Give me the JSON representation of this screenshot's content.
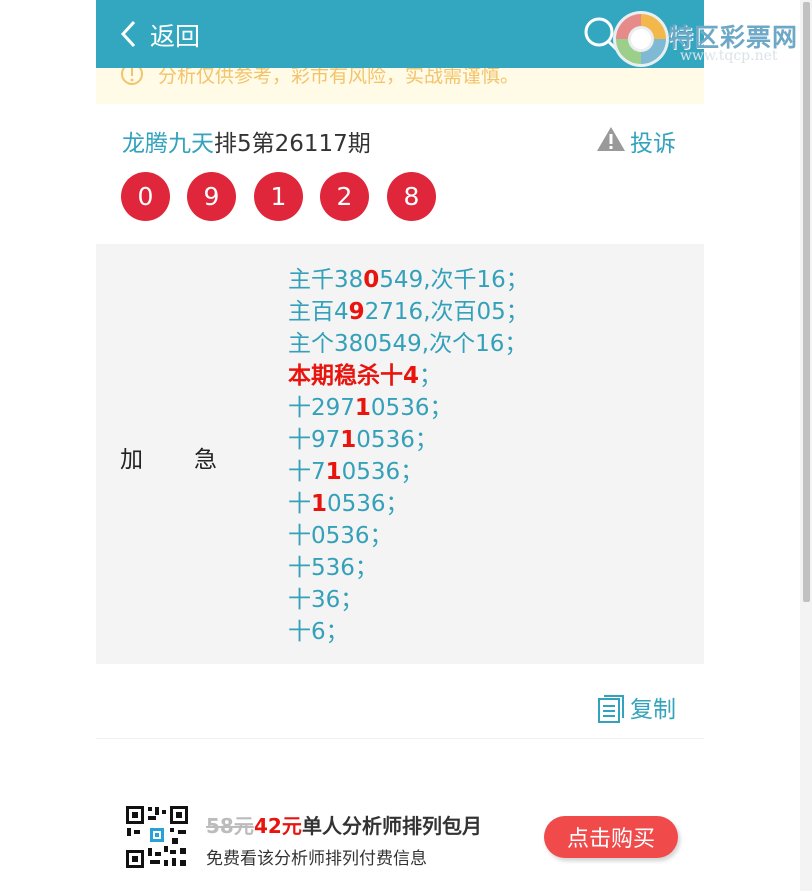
{
  "header": {
    "back_label": "返回"
  },
  "watermark": {
    "title": "特区彩票网",
    "url": "www.tqcp.net"
  },
  "notice": {
    "text": "分析仅供参考，彩市有风险，实战需谨慎。"
  },
  "post": {
    "author": "龙腾九天",
    "issue": "排5第26117期",
    "complain_label": "投诉",
    "balls": [
      "0",
      "9",
      "1",
      "2",
      "8"
    ]
  },
  "analysis": {
    "tag_part1": "加",
    "tag_part2": "急",
    "lines": [
      {
        "a": "主千38",
        "b": "0",
        "c": "549,次千16；"
      },
      {
        "a": "主百4",
        "b": "9",
        "c": "2716,次百05；"
      },
      {
        "a": "主个380549,次个16；",
        "b": "",
        "c": ""
      },
      {
        "a": "",
        "b": "本期稳杀十4",
        "c": "；"
      },
      {
        "a": "十297",
        "b": "1",
        "c": "0536；"
      },
      {
        "a": "十97",
        "b": "1",
        "c": "0536；"
      },
      {
        "a": "十7",
        "b": "1",
        "c": "0536；"
      },
      {
        "a": "十",
        "b": "1",
        "c": "0536；"
      },
      {
        "a": "十0536；",
        "b": "",
        "c": ""
      },
      {
        "a": "十536；",
        "b": "",
        "c": ""
      },
      {
        "a": "十36；",
        "b": "",
        "c": ""
      },
      {
        "a": "十6；",
        "b": "",
        "c": ""
      }
    ]
  },
  "copy_label": "复制",
  "promo": {
    "price_old": "58元",
    "price_new": "42元",
    "title": "单人分析师排列包月",
    "subtitle": "免费看该分析师排列付费信息",
    "button_label": "点击购买"
  }
}
